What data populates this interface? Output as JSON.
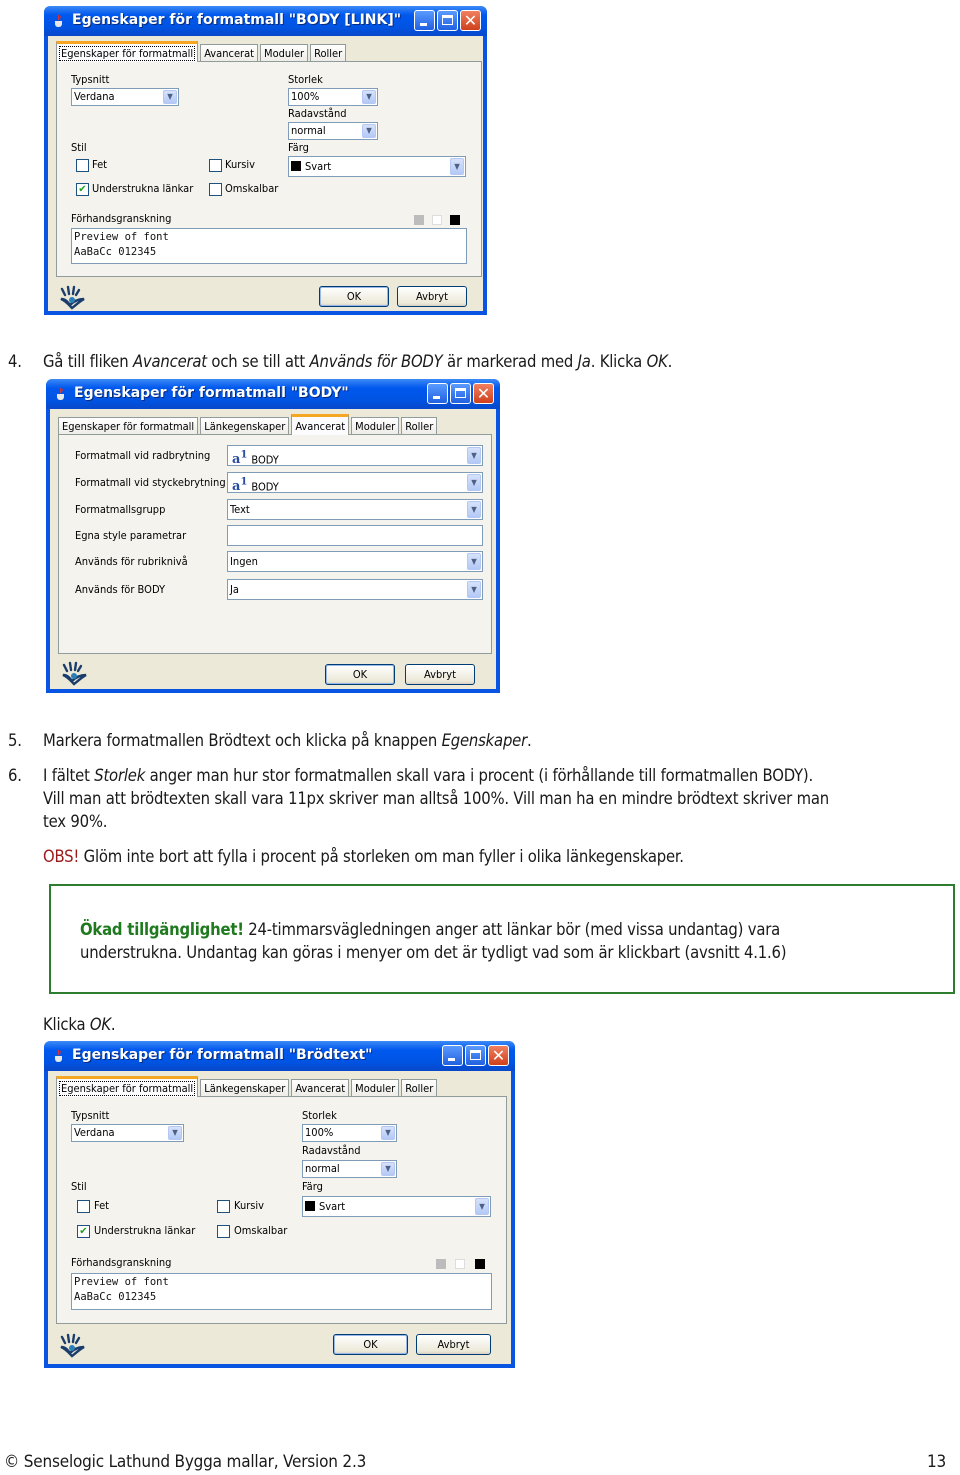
{
  "dialogs": [
    {
      "title": "Egenskaper för formatmall \"BODY [LINK]\"",
      "tabs": [
        "Egenskaper för formatmall",
        "Avancerat",
        "Moduler",
        "Roller"
      ],
      "active_tab": "Egenskaper för formatmall",
      "typsnitt_label": "Typsnitt",
      "typsnitt_value": "Verdana",
      "storlek_label": "Storlek",
      "storlek_value": "100%",
      "radavstand_label": "Radavstånd",
      "radavstand_value": "normal",
      "stil_label": "Stil",
      "farg_label": "Färg",
      "farg_value": "Svart",
      "fet_label": "Fet",
      "fet_checked": false,
      "kursiv_label": "Kursiv",
      "kursiv_checked": false,
      "understrukna_label": "Understrukna länkar",
      "understrukna_checked": true,
      "omskalbar_label": "Omskalbar",
      "omskalbar_checked": false,
      "preview_label": "Förhandsgranskning",
      "preview_line1": "Preview of font",
      "preview_line2": "AaBaCc 012345",
      "ok_label": "OK",
      "cancel_label": "Avbryt"
    },
    {
      "title": "Egenskaper för formatmall \"BODY\"",
      "tabs": [
        "Egenskaper för formatmall",
        "Länkegenskaper",
        "Avancerat",
        "Moduler",
        "Roller"
      ],
      "active_tab": "Avancerat",
      "rows": [
        {
          "label": "Formatmall vid radbrytning",
          "value": "BODY",
          "icon": "style-a1-icon",
          "type": "combo"
        },
        {
          "label": "Formatmall vid styckebrytning",
          "value": "BODY",
          "icon": "style-a1-icon",
          "type": "combo"
        },
        {
          "label": "Formatmallsgrupp",
          "value": "Text",
          "type": "combo"
        },
        {
          "label": "Egna style parametrar",
          "value": "",
          "type": "text"
        },
        {
          "label": "Används för rubriknivå",
          "value": "Ingen",
          "type": "combo"
        },
        {
          "label": "Används för BODY",
          "value": "Ja",
          "type": "combo"
        }
      ],
      "ok_label": "OK",
      "cancel_label": "Avbryt"
    },
    {
      "title": "Egenskaper för formatmall \"Brödtext\"",
      "tabs": [
        "Egenskaper för formatmall",
        "Länkegenskaper",
        "Avancerat",
        "Moduler",
        "Roller"
      ],
      "active_tab": "Egenskaper för formatmall",
      "typsnitt_label": "Typsnitt",
      "typsnitt_value": "Verdana",
      "storlek_label": "Storlek",
      "storlek_value": "100%",
      "radavstand_label": "Radavstånd",
      "radavstand_value": "normal",
      "stil_label": "Stil",
      "farg_label": "Färg",
      "farg_value": "Svart",
      "fet_label": "Fet",
      "fet_checked": false,
      "kursiv_label": "Kursiv",
      "kursiv_checked": false,
      "understrukna_label": "Understrukna länkar",
      "understrukna_checked": true,
      "omskalbar_label": "Omskalbar",
      "omskalbar_checked": false,
      "preview_label": "Förhandsgranskning",
      "preview_line1": "Preview of font",
      "preview_line2": "AaBaCc 012345",
      "ok_label": "OK",
      "cancel_label": "Avbryt"
    }
  ],
  "steps": {
    "step4": {
      "num": "4.",
      "parts": [
        "Gå till fliken ",
        "Avancerat",
        " och se till att ",
        "Används för BODY",
        " är markerad med ",
        "Ja",
        ". Klicka ",
        "OK",
        "."
      ]
    },
    "step5": {
      "num": "5.",
      "parts": [
        "Markera formatmallen Brödtext och klicka på knappen ",
        "Egenskaper",
        "."
      ]
    },
    "step6": {
      "num": "6.",
      "parts": [
        "I fältet ",
        "Storlek",
        " anger man hur stor formatmallen skall vara i procent (i förhållande till formatmallen BODY)."
      ],
      "line2": "Vill man att brödtexten skall vara 11px skriver man alltså 100%. Vill man ha en mindre brödtext skriver man",
      "line3": "tex 90%."
    },
    "obs": {
      "label": "OBS!",
      "text": " Glöm inte bort att fylla i procent på storleken om man fyller i olika länkegenskaper."
    },
    "callout": {
      "label": "Ökad tillgänglighet!",
      "line1": " 24-timmarsvägledningen anger att länkar bör (med vissa undantag) vara",
      "line2": "understrukna.  Undantag kan göras i menyer om det är tydligt vad som är klickbart (avsnitt 4.1.6)"
    },
    "klicka_ok": {
      "parts": [
        "Klicka ",
        "OK",
        "."
      ]
    }
  },
  "footer": {
    "copyright": "© Senselogic Lathund Bygga mallar, Version 2.3",
    "page_number": "13"
  },
  "colors": {
    "obs": "#9b1a1a",
    "callout_accent": "#1f7a1f",
    "xp_titlebar": "#0054e3",
    "dialog_bg": "#ece9d8"
  }
}
